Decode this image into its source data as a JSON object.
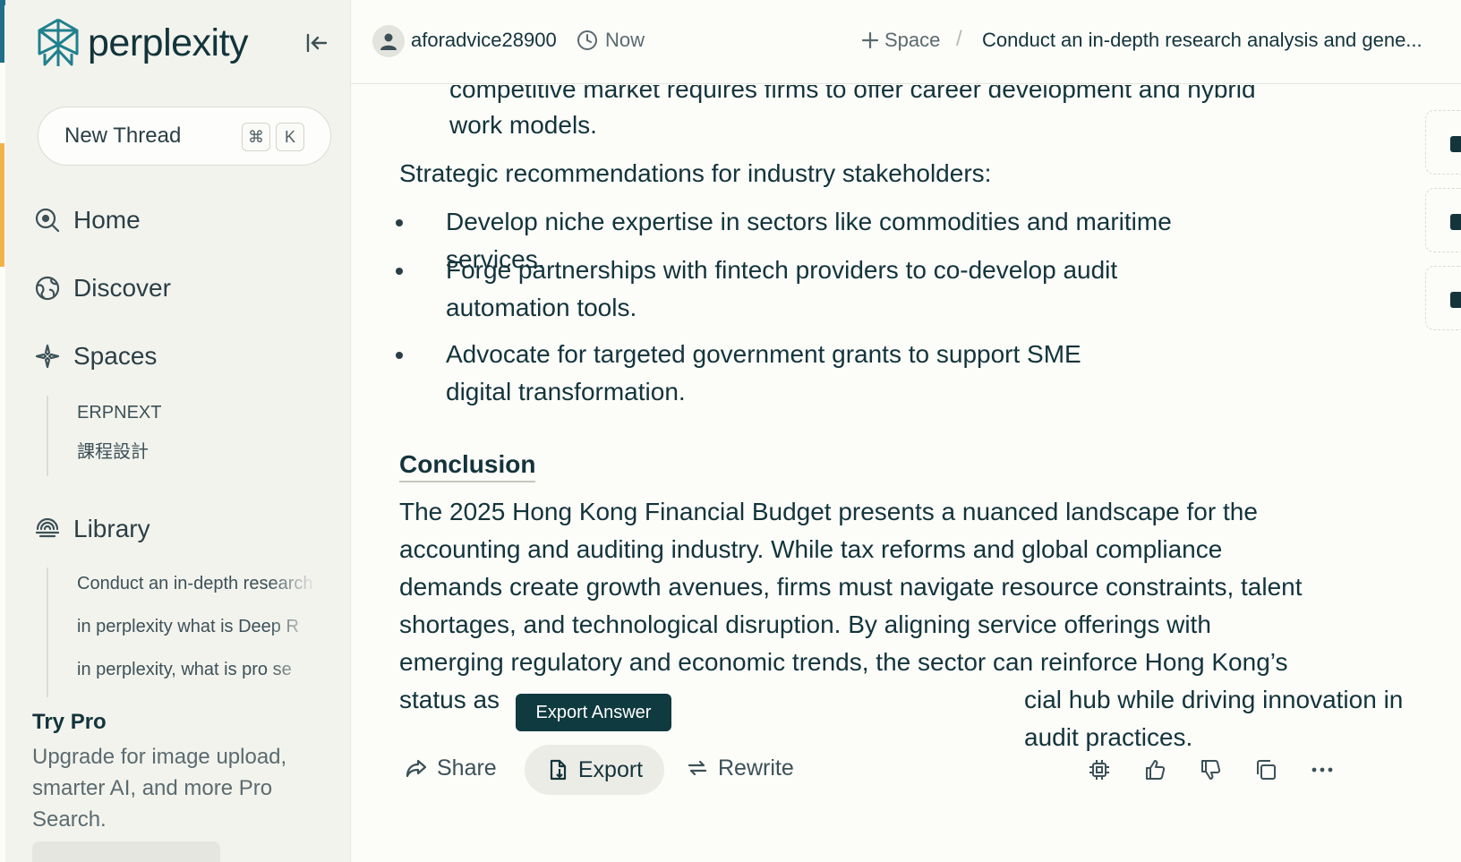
{
  "brand": {
    "name": "perplexity",
    "accent": "#20808d"
  },
  "sidebar": {
    "new_thread": "New Thread",
    "shortcut_keys": [
      "⌘",
      "K"
    ],
    "nav": [
      {
        "label": "Home",
        "icon": "home-icon"
      },
      {
        "label": "Discover",
        "icon": "globe-icon"
      },
      {
        "label": "Spaces",
        "icon": "sparkle-icon"
      },
      {
        "label": "Library",
        "icon": "library-icon"
      }
    ],
    "spaces": [
      "ERPNEXT",
      "課程設計"
    ],
    "library": [
      "Conduct an in-depth research",
      "in perplexity what is Deep R",
      "in perplexity, what is pro se"
    ],
    "try_pro": {
      "title": "Try Pro",
      "description": "Upgrade for image upload, smarter AI, and more Pro Search."
    }
  },
  "header": {
    "username": "aforadvice28900",
    "time": "Now",
    "space": "Space",
    "breadcrumb": "Conduct an in-depth research analysis and gene..."
  },
  "content": {
    "prev_line_1": "competitive market requires firms to offer career development and hybrid",
    "prev_line_2": "work models.",
    "recommend_heading": "Strategic recommendations for industry stakeholders:",
    "bullets": [
      [
        "Develop niche expertise in sectors like commodities and maritime services."
      ],
      [
        "Forge partnerships with fintech providers to co-develop audit",
        "automation tools."
      ],
      [
        "Advocate for targeted government grants to support SME",
        "digital transformation."
      ]
    ],
    "conclusion_title": "Conclusion",
    "conclusion_lines": [
      "The 2025 Hong Kong Financial Budget presents a nuanced landscape for the",
      "accounting and auditing industry. While tax reforms and global compliance",
      "demands create growth avenues, firms must navigate resource constraints, talent",
      "shortages, and technological disruption. By aligning service offerings with",
      "emerging regulatory and economic trends, the sector can reinforce Hong Kong’s"
    ],
    "conclusion_last_a": "status as",
    "conclusion_last_b": "cial hub while driving innovation in audit practices."
  },
  "tooltip": "Export Answer",
  "actions": {
    "share": "Share",
    "export": "Export",
    "rewrite": "Rewrite"
  }
}
